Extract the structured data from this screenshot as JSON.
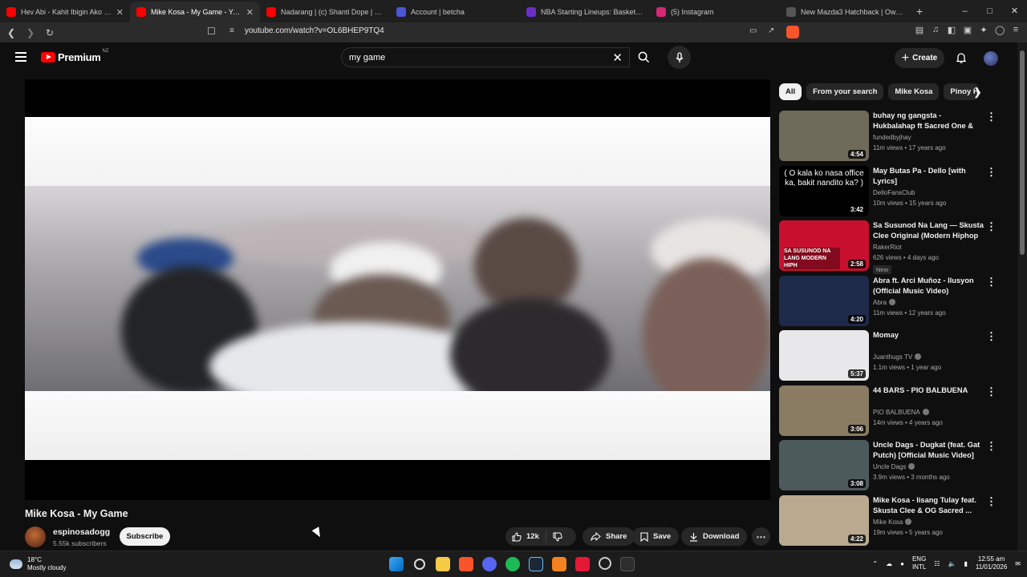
{
  "browser": {
    "tabs": [
      {
        "title": "Hev Abi - Kahit Ibigin Ako Mali - Yo...",
        "favicon_color": "#ff0000"
      },
      {
        "title": "Mike Kosa - My Game - YouT...",
        "favicon_color": "#ff0000"
      },
      {
        "title": "Nadarang | (c) Shanti Dope | #Agsun...",
        "favicon_color": "#ff0000"
      },
      {
        "title": "Account | betcha",
        "favicon_color": "#4b57d6"
      },
      {
        "title": "NBA Starting Lineups: Basketball Da...",
        "favicon_color": "#6b2fc8"
      },
      {
        "title": "(5) Instagram",
        "favicon_color": "#d62976"
      },
      {
        "title": "New Mazda3 Hatchback | Own The ...",
        "favicon_color": "#555555"
      }
    ],
    "url": "youtube.com/watch?v=OL6BHEP9TQ4"
  },
  "header": {
    "logo_text": "Premium",
    "region": "NZ",
    "search_value": "my game",
    "create_label": "Create"
  },
  "video": {
    "title": "Mike Kosa - My Game",
    "channel": "espinosadogg",
    "subscribers": "5.55k subscribers",
    "subscribe_label": "Subscribe",
    "likes": "12k",
    "share_label": "Share",
    "save_label": "Save",
    "download_label": "Download"
  },
  "chips": [
    "All",
    "From your search",
    "Mike Kosa",
    "Pinoy H"
  ],
  "related": [
    {
      "title": "buhay ng gangsta - Hukbalahap ft Sacred One & Bradux",
      "channel": "fundedbyjhay",
      "meta": "11m views • 17 years ago",
      "duration": "4:54",
      "verified": false,
      "thumb": "#6d6a5a",
      "new": ""
    },
    {
      "title": "May Butas Pa - Dello [with Lyrics]",
      "channel": "DelloFansClub",
      "meta": "10m views • 15 years ago",
      "duration": "3:42",
      "verified": false,
      "thumb": "#000000",
      "new": ""
    },
    {
      "title": "Sa Susunod Na Lang — Skusta Clee Original (Modern Hiphop ...",
      "channel": "RakerRiot",
      "meta": "626 views • 4 days ago",
      "duration": "2:58",
      "verified": false,
      "thumb": "#c8102e",
      "new": "New"
    },
    {
      "title": "Abra ft. Arci Muñoz - Ilusyon (Official Music Video)",
      "channel": "Abra",
      "meta": "11m views • 12 years ago",
      "duration": "4:20",
      "verified": true,
      "thumb": "#1d2a4a",
      "new": ""
    },
    {
      "title": "Momay",
      "channel": "Juanthugs TV",
      "meta": "1.1m views • 1 year ago",
      "duration": "5:37",
      "verified": true,
      "thumb": "#e8e8ea",
      "new": ""
    },
    {
      "title": "44 BARS - PIO BALBUENA",
      "channel": "PIO BALBUENA",
      "meta": "14m views • 4 years ago",
      "duration": "3:06",
      "verified": true,
      "thumb": "#8a7b63",
      "new": ""
    },
    {
      "title": "Uncle Dags - Dugkat (feat. Gat Putch) [Official Music Video]",
      "channel": "Uncle Dags",
      "meta": "3.9m views • 3 months ago",
      "duration": "3:08",
      "verified": true,
      "thumb": "#4d5a5c",
      "new": ""
    },
    {
      "title": "Mike Kosa - Iisang Tulay feat. Skusta Clee & OG Sacred ...",
      "channel": "Mike Kosa",
      "meta": "19m views • 5 years ago",
      "duration": "4:22",
      "verified": true,
      "thumb": "#b9a98f",
      "new": ""
    }
  ],
  "thumb_text_2": "( O kala ko nasa office ka, bakit nandito ka? )",
  "thumb_text_3": "SA SUSUNOD NA LANG MODERN HIPH",
  "taskbar": {
    "temp": "18°C",
    "weather": "Mostly cloudy",
    "lang1": "ENG",
    "lang2": "INTL",
    "time": "12:55 am",
    "date": "11/01/2026"
  }
}
